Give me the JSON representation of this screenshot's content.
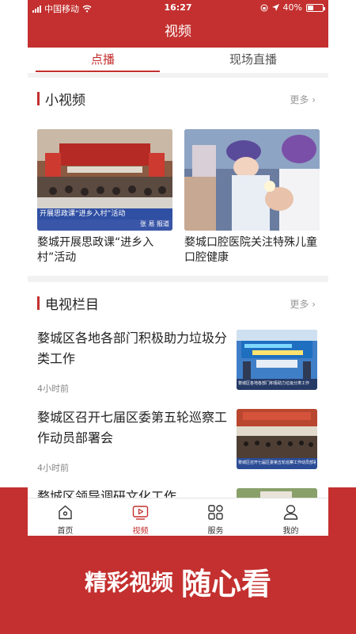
{
  "status_bar": {
    "carrier": "中国移动",
    "time": "16:27",
    "battery": "40%",
    "battery_level": 0.4
  },
  "header": {
    "title": "视频"
  },
  "tabs": [
    {
      "label": "点播",
      "active": true
    },
    {
      "label": "现场直播",
      "active": false
    }
  ],
  "short_videos": {
    "title": "小视频",
    "more": "更多",
    "items": [
      {
        "title": "婺城开展思政课“进乡入村”活动",
        "caption": "开展思政课“进乡入村”活动",
        "credit": "张 易  报道"
      },
      {
        "title": "婺城口腔医院关注特殊儿童口腔健康"
      }
    ]
  },
  "tv_columns": {
    "title": "电视栏目",
    "more": "更多",
    "items": [
      {
        "title": "婺城区各地各部门积极助力垃圾分类工作",
        "time": "4小时前",
        "caption": "婺城区各地各部门积极助力垃圾分类工作"
      },
      {
        "title": "婺城区召开七届区委第五轮巡察工作动员部署会",
        "time": "4小时前",
        "caption": "婺城区召开七届区委第五轮巡察工作动员部署会"
      },
      {
        "title": "婺城区领导调研文化工作"
      }
    ]
  },
  "tabbar": [
    {
      "label": "首页",
      "icon": "home-icon",
      "active": false
    },
    {
      "label": "视频",
      "icon": "video-icon",
      "active": true
    },
    {
      "label": "服务",
      "icon": "grid-icon",
      "active": false
    },
    {
      "label": "我的",
      "icon": "user-icon",
      "active": false
    }
  ],
  "slogan": {
    "part1": "精彩视频",
    "part2": "随心看"
  },
  "colors": {
    "brand": "#c3302f",
    "background": "#f2f2f2",
    "text": "#222222",
    "muted": "#888888"
  }
}
